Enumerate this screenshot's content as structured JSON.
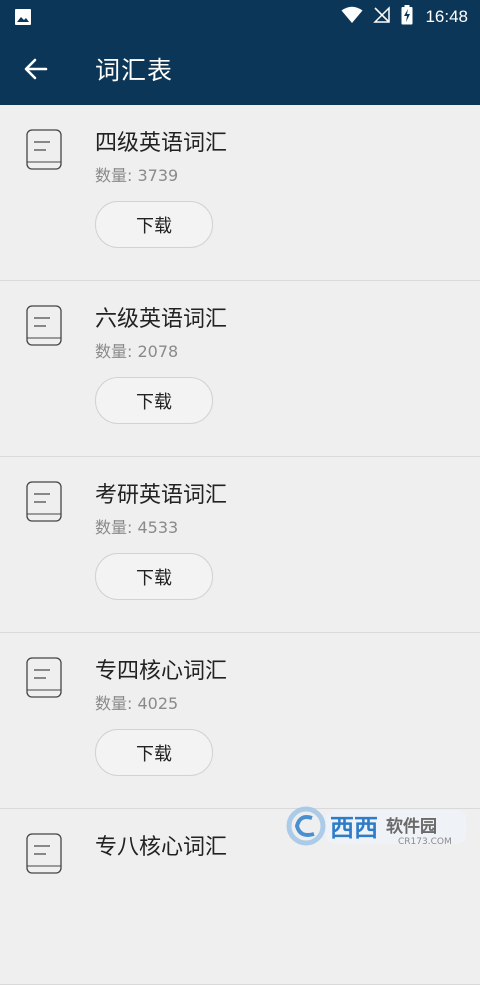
{
  "status_bar": {
    "time": "16:48"
  },
  "app_bar": {
    "title": "词汇表"
  },
  "vocab_list": [
    {
      "name": "四级英语词汇",
      "count": "数量: 3739",
      "button": "下载"
    },
    {
      "name": "六级英语词汇",
      "count": "数量: 2078",
      "button": "下载"
    },
    {
      "name": "考研英语词汇",
      "count": "数量: 4533",
      "button": "下载"
    },
    {
      "name": "专四核心词汇",
      "count": "数量: 4025",
      "button": "下载"
    },
    {
      "name": "专八核心词汇"
    }
  ],
  "watermark": {
    "brand": "西西",
    "suffix": "软件园",
    "domain": "CR173.COM"
  },
  "colors": {
    "header": "#0c3657",
    "background": "#efefef"
  }
}
